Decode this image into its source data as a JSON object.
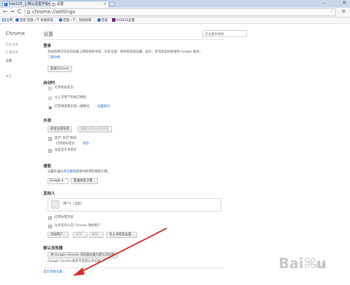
{
  "tabs": [
    {
      "title": "hao123_上网从这里开始"
    },
    {
      "title": "设置"
    }
  ],
  "window_controls": {
    "minimize": "–",
    "close": "✕"
  },
  "toolbar": {
    "back": "←",
    "forward": "→",
    "reload": "C",
    "url": "chrome://settings",
    "star": "☆",
    "menu": "≡"
  },
  "bookmarks": [
    {
      "label": "应用"
    },
    {
      "label": "百度 百度一下 你就知道"
    },
    {
      "label": "百度一下，你就知道"
    },
    {
      "label": "百度"
    },
    {
      "label": "VS2015正版"
    }
  ],
  "sidebar": {
    "brand": "Chrome",
    "items": [
      {
        "label": "历史记录"
      },
      {
        "label": "扩展程序"
      },
      {
        "label": "设置"
      },
      {
        "label": "关于"
      }
    ]
  },
  "page": {
    "title": "设置",
    "search_placeholder": "在设置中搜索"
  },
  "login": {
    "heading": "登录",
    "desc1": "登录后即可在任何设备上获取您的书签、历史记录、密码和其他设置。此外，您还会自动登录到 Google 服务。",
    "learn_more": "了解详情",
    "button": "登录Chrome"
  },
  "startup": {
    "heading": "启动时",
    "options": [
      {
        "label": "打开新标签页",
        "selected": false
      },
      {
        "label": "从上次停下的地方继续",
        "selected": false
      },
      {
        "label": "打开特定网页或一组网页。",
        "selected": true
      }
    ],
    "set_pages": "设置网页"
  },
  "appearance": {
    "heading": "外观",
    "get_themes": "获取主题背景",
    "reset_theme": "重置为默认主题背景",
    "show_home": "显示\"主页\"按钮",
    "home_sub": "打开新标签页",
    "change": "更改",
    "show_bookmarks": "总是显示书签栏"
  },
  "search": {
    "heading": "搜索",
    "desc_pre": "设置在通过",
    "omnibox": "多功能框",
    "desc_post": "搜索时所用的搜索引擎。",
    "engine": "Google",
    "manage": "管理搜索引擎..."
  },
  "people": {
    "heading": "其他人",
    "user": "用户1（当前）",
    "guest": "启用访客浏览",
    "allow_add": "允许任何人向 Chrome 添加用户",
    "add": "添加用户...",
    "edit": "修改...",
    "remove": "删除...",
    "import": "导入书签和设置..."
  },
  "default_browser": {
    "heading": "默认浏览器",
    "make_default": "将 Google Chrome 浏览器设置为默认浏览器",
    "status": "Google Chrome目前不是默认浏览器。"
  },
  "advanced_link": "显示高级设置...",
  "watermark": "Baidu 经验",
  "colors": {
    "accent": "#2e6fd6",
    "arrow": "#d9302c"
  }
}
